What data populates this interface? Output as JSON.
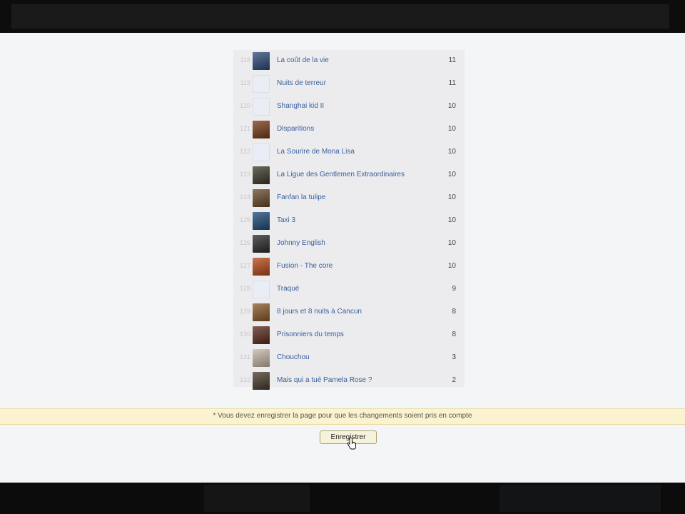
{
  "header": {
    "title": ""
  },
  "list": {
    "rows": [
      {
        "rank": "118",
        "title": "La coût de la vie",
        "votes": "11",
        "thumb": "poster-icon",
        "color": "#2c4a7a"
      },
      {
        "rank": "119",
        "title": "Nuits de terreur",
        "votes": "11",
        "thumb": "blank-poster-icon",
        "color": "#e8edf6"
      },
      {
        "rank": "120",
        "title": "Shanghai kid II",
        "votes": "10",
        "thumb": "blank-poster-icon",
        "color": "#e8edf6"
      },
      {
        "rank": "121",
        "title": "Disparitions",
        "votes": "10",
        "thumb": "poster-icon",
        "color": "#7a3a18"
      },
      {
        "rank": "122",
        "title": "La Sourire de Mona Lisa",
        "votes": "10",
        "thumb": "blank-poster-icon",
        "color": "#e8edf6"
      },
      {
        "rank": "123",
        "title": "La Ligue des Gentlemen Extraordinaires",
        "votes": "10",
        "thumb": "poster-icon",
        "color": "#3a3a2a"
      },
      {
        "rank": "124",
        "title": "Fanfan la tulipe",
        "votes": "10",
        "thumb": "poster-icon",
        "color": "#6a4a2a"
      },
      {
        "rank": "125",
        "title": "Taxi 3",
        "votes": "10",
        "thumb": "poster-icon",
        "color": "#1e4a78"
      },
      {
        "rank": "126",
        "title": "Johnny English",
        "votes": "10",
        "thumb": "poster-icon",
        "color": "#2a2a2a"
      },
      {
        "rank": "127",
        "title": "Fusion - The core",
        "votes": "10",
        "thumb": "poster-icon",
        "color": "#b84a18"
      },
      {
        "rank": "128",
        "title": "Traqué",
        "votes": "9",
        "thumb": "blank-poster-icon",
        "color": "#e8edf6"
      },
      {
        "rank": "129",
        "title": "8 jours et 8 nuits à Cancun",
        "votes": "8",
        "thumb": "poster-icon",
        "color": "#8a5a2a"
      },
      {
        "rank": "130",
        "title": "Prisonniers du temps",
        "votes": "8",
        "thumb": "poster-icon",
        "color": "#5a2a1a"
      },
      {
        "rank": "131",
        "title": "Chouchou",
        "votes": "3",
        "thumb": "poster-icon",
        "color": "#c8b8a8"
      },
      {
        "rank": "132",
        "title": "Mais qui a tué Pamela Rose ?",
        "votes": "2",
        "thumb": "poster-icon",
        "color": "#4a3a2a"
      }
    ]
  },
  "notice": {
    "text": "* Vous devez enregistrer la page pour que les changements soient pris en compte"
  },
  "actions": {
    "save_label": "Enregistrer"
  },
  "colors": {
    "link": "#365f9c",
    "notice_bg": "#fbf3cf"
  }
}
